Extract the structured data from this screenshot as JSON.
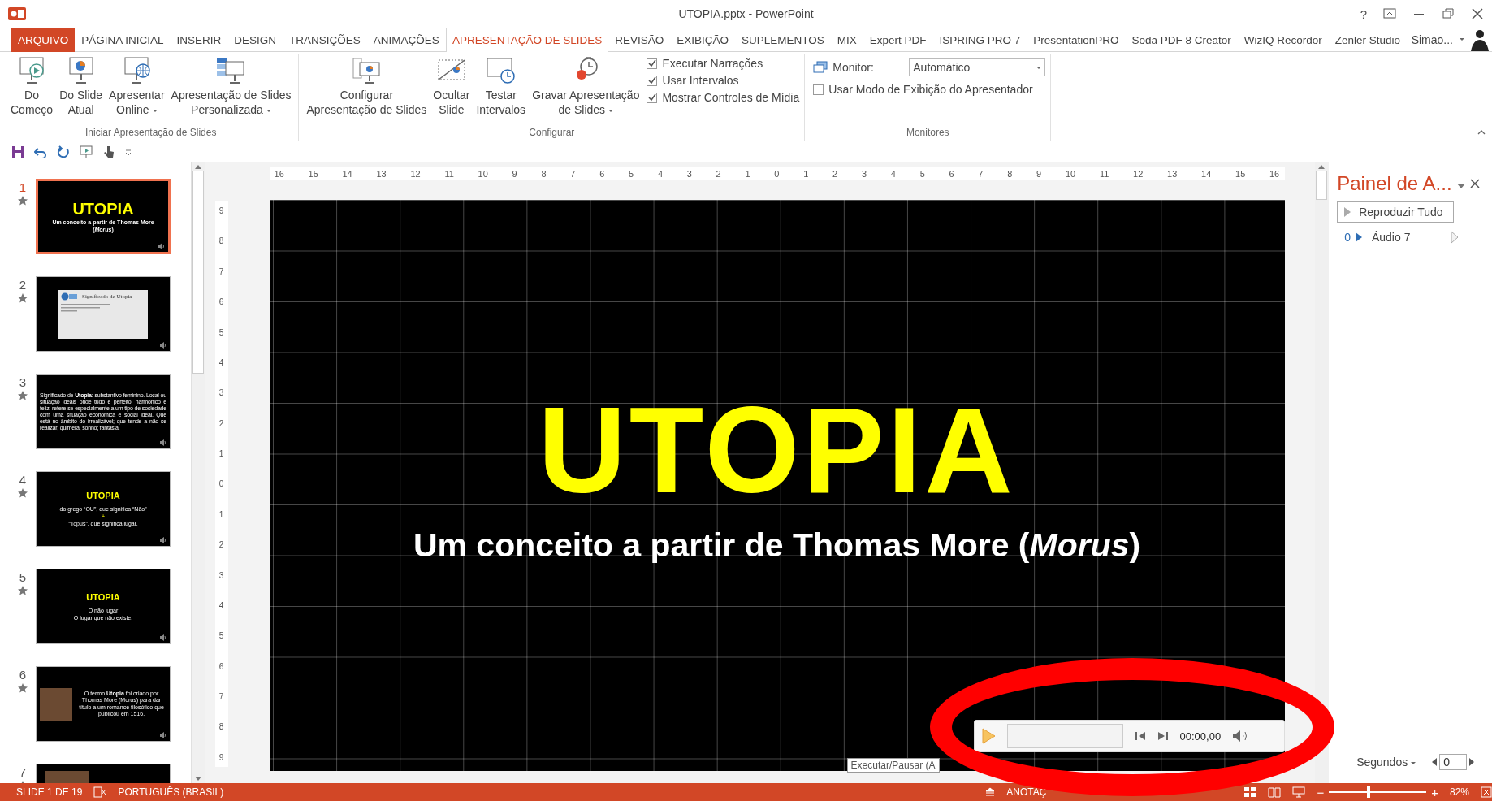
{
  "window": {
    "title": "UTOPIA.pptx - PowerPoint",
    "help": "?"
  },
  "tabs": [
    {
      "label": "ARQUIVO",
      "kind": "file",
      "selected": false
    },
    {
      "label": "PÁGINA INICIAL",
      "kind": "tab",
      "selected": false
    },
    {
      "label": "INSERIR",
      "kind": "tab",
      "selected": false
    },
    {
      "label": "DESIGN",
      "kind": "tab",
      "selected": false
    },
    {
      "label": "TRANSIÇÕES",
      "kind": "tab",
      "selected": false
    },
    {
      "label": "ANIMAÇÕES",
      "kind": "tab",
      "selected": false
    },
    {
      "label": "APRESENTAÇÃO DE SLIDES",
      "kind": "tab",
      "selected": true
    },
    {
      "label": "REVISÃO",
      "kind": "tab",
      "selected": false
    },
    {
      "label": "EXIBIÇÃO",
      "kind": "tab",
      "selected": false
    },
    {
      "label": "SUPLEMENTOS",
      "kind": "tab",
      "selected": false
    },
    {
      "label": "MIX",
      "kind": "tab",
      "selected": false
    },
    {
      "label": "Expert PDF",
      "kind": "tab",
      "selected": false
    },
    {
      "label": "ISPRING PRO 7",
      "kind": "tab",
      "selected": false
    },
    {
      "label": "PresentationPRO",
      "kind": "tab",
      "selected": false
    },
    {
      "label": "Soda PDF 8 Creator",
      "kind": "tab",
      "selected": false
    },
    {
      "label": "WizIQ Recordor",
      "kind": "tab",
      "selected": false
    },
    {
      "label": "Zenler Studio",
      "kind": "tab",
      "selected": false
    }
  ],
  "user": {
    "name": "Simao..."
  },
  "ribbon": {
    "groups": [
      {
        "label": "Iniciar Apresentação de Slides",
        "items": [
          {
            "kind": "large",
            "lines": [
              "Do",
              "Começo"
            ],
            "dropdown": false
          },
          {
            "kind": "large",
            "lines": [
              "Do Slide",
              "Atual"
            ],
            "dropdown": false
          },
          {
            "kind": "large",
            "lines": [
              "Apresentar",
              "Online"
            ],
            "dropdown": true
          },
          {
            "kind": "large",
            "lines": [
              "Apresentação de Slides",
              "Personalizada"
            ],
            "dropdown": true
          }
        ]
      },
      {
        "label": "Configurar",
        "items": [
          {
            "kind": "large",
            "lines": [
              "Configurar",
              "Apresentação de Slides"
            ],
            "dropdown": false
          },
          {
            "kind": "large",
            "lines": [
              "Ocultar",
              "Slide"
            ],
            "dropdown": false
          },
          {
            "kind": "large",
            "lines": [
              "Testar",
              "Intervalos"
            ],
            "dropdown": false
          },
          {
            "kind": "large",
            "lines": [
              "Gravar Apresentação",
              "de Slides"
            ],
            "dropdown": true
          },
          {
            "kind": "checks",
            "items": [
              {
                "label": "Executar Narrações",
                "checked": true
              },
              {
                "label": "Usar Intervalos",
                "checked": true
              },
              {
                "label": "Mostrar Controles de Mídia",
                "checked": true
              }
            ]
          }
        ]
      },
      {
        "label": "Monitores",
        "items": [
          {
            "kind": "monitor",
            "label": "Monitor:",
            "value": "Automático"
          },
          {
            "kind": "checks",
            "items": [
              {
                "label": "Usar Modo de Exibição do Apresentador",
                "checked": false
              }
            ]
          }
        ]
      }
    ]
  },
  "slides": [
    {
      "number": "1",
      "selected": true,
      "kind": "title",
      "title": "UTOPIA",
      "subtitle": "Um conceito a partir de Thomas More (*Morus*)"
    },
    {
      "number": "2",
      "selected": false,
      "kind": "screenshot",
      "title": "Significado de Utopia"
    },
    {
      "number": "3",
      "selected": false,
      "kind": "paragraph",
      "text": "Significado de **Utopia**: substantivo feminino. Local ou situação ideais onde tudo é perfeito, harmônico e feliz; refere-se especialmente a um tipo de sociedade com uma situação econômica e social ideal. Que está no âmbito do irrealizável; que tende a não se realizar; quimera, sonho; fantasia."
    },
    {
      "number": "4",
      "selected": false,
      "kind": "title-lines",
      "title": "UTOPIA",
      "lines": [
        {
          "text": "do grego “OU”, que significa “Não”",
          "accent": false
        },
        {
          "text": "+",
          "accent": true
        },
        {
          "text": "“Topus”, que significa lugar.",
          "accent": false
        }
      ]
    },
    {
      "number": "5",
      "selected": false,
      "kind": "title-lines",
      "title": "UTOPIA",
      "lines": [
        {
          "text": "O não lugar",
          "accent": false
        },
        {
          "text": "O lugar que não existe.",
          "accent": false
        }
      ]
    },
    {
      "number": "6",
      "selected": false,
      "kind": "portrait",
      "text": "O termo **Utopia** foi criado por Thomas More (Morus) para dar título a um romance filosófico que publicou em 1516."
    },
    {
      "number": "7",
      "selected": false,
      "kind": "photo"
    }
  ],
  "editor": {
    "horizontal_ruler": [
      "16",
      "15",
      "14",
      "13",
      "12",
      "11",
      "10",
      "9",
      "8",
      "7",
      "6",
      "5",
      "4",
      "3",
      "2",
      "1",
      "0",
      "1",
      "2",
      "3",
      "4",
      "5",
      "6",
      "7",
      "8",
      "9",
      "10",
      "11",
      "12",
      "13",
      "14",
      "15",
      "16"
    ],
    "vertical_ruler": [
      "9",
      "8",
      "7",
      "6",
      "5",
      "4",
      "3",
      "2",
      "1",
      "0",
      "1",
      "2",
      "3",
      "4",
      "5",
      "6",
      "7",
      "8",
      "9"
    ],
    "slide": {
      "title": "UTOPIA",
      "subtitle": "Um conceito a partir de Thomas More (*Morus*)"
    },
    "media": {
      "time": "00:00,00"
    },
    "tooltip": "Executar/Pausar (A"
  },
  "animation_pane": {
    "title": "Painel de A...",
    "play_all": "Reproduzir Tudo",
    "items": [
      {
        "number": "0",
        "name": "Áudio 7"
      }
    ],
    "units": "Segundos",
    "value": "0"
  },
  "status_bar": {
    "slide": "SLIDE 1 DE 19",
    "language": "PORTUGUÊS (BRASIL)",
    "notes": "ANOTAÇ",
    "zoom_out": "−",
    "zoom_in": "+",
    "zoom": "82%",
    "zoom_slider": {
      "level": 0.41
    }
  }
}
